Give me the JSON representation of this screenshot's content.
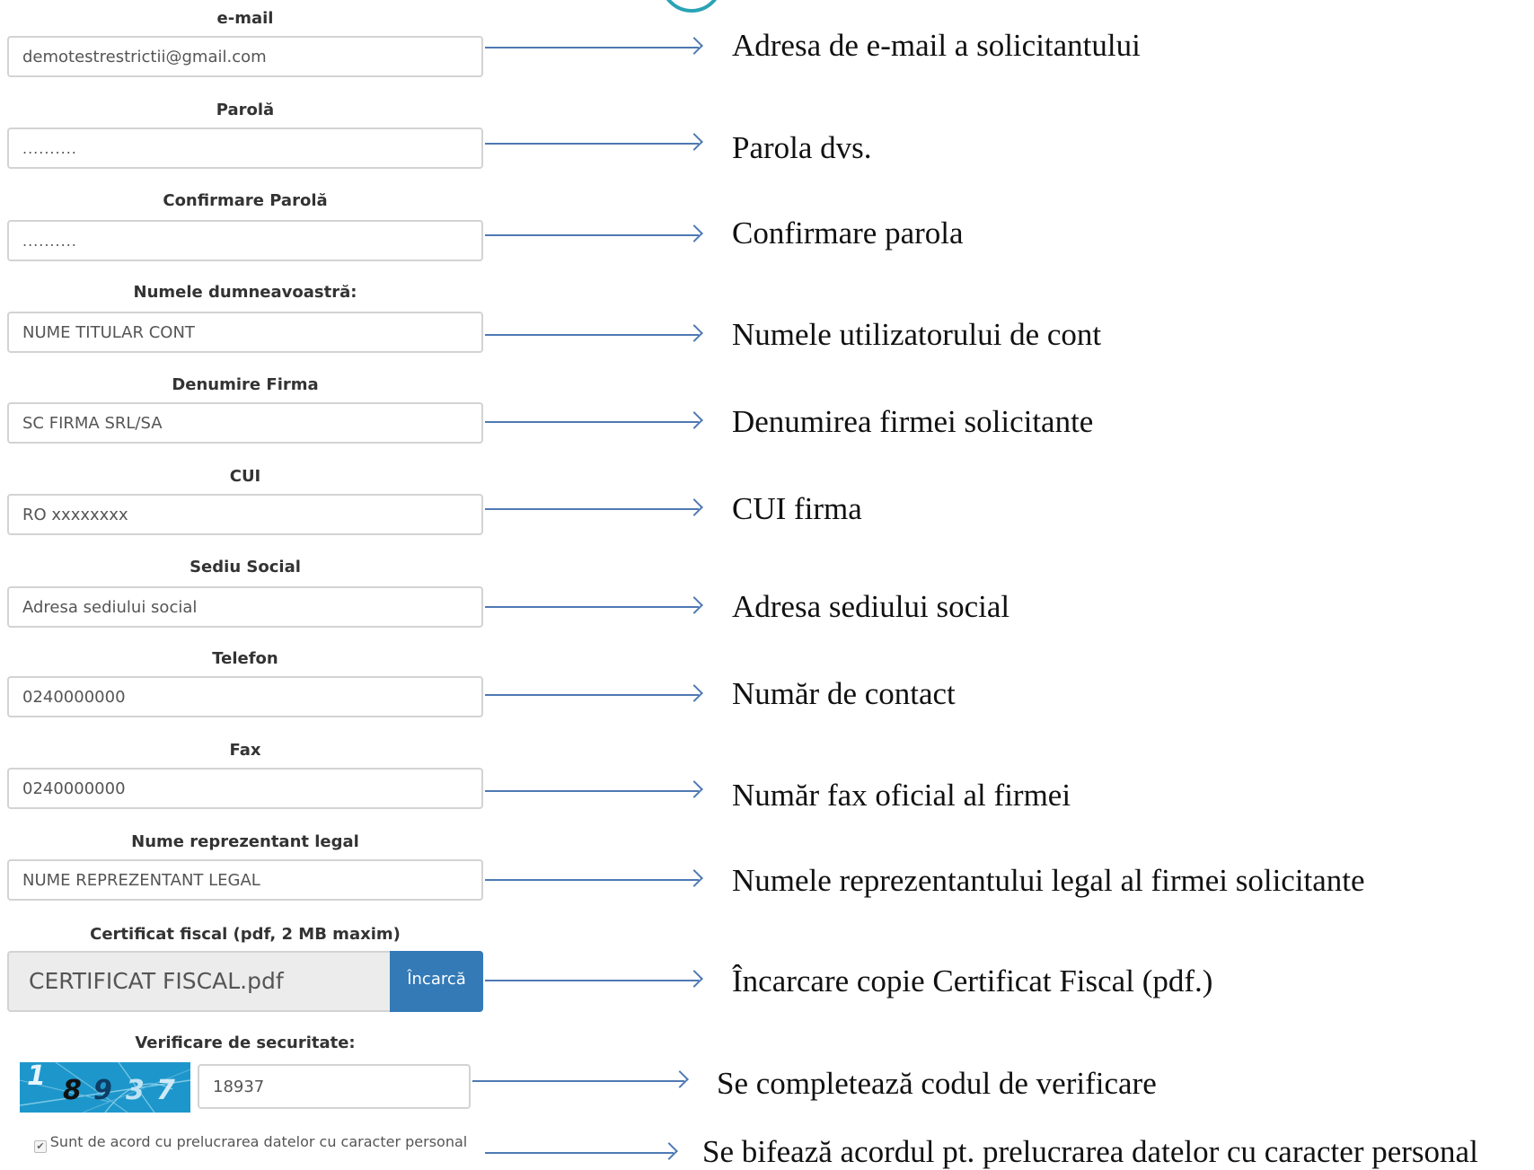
{
  "form": {
    "email": {
      "label": "e-mail",
      "value": "demotestrestrictii@gmail.com",
      "note": "Adresa de e-mail a solicitantului"
    },
    "password": {
      "label": "Parolă",
      "value": "..........",
      "note": "Parola dvs."
    },
    "confirm_password": {
      "label": "Confirmare Parolă",
      "value": "..........",
      "note": "Confirmare parola"
    },
    "name": {
      "label": "Numele dumneavoastră:",
      "value": "NUME TITULAR CONT",
      "note": "Numele utilizatorului de cont"
    },
    "company": {
      "label": "Denumire Firma",
      "value": "SC FIRMA SRL/SA",
      "note": "Denumirea firmei solicitante"
    },
    "cui": {
      "label": "CUI",
      "value": "RO xxxxxxxx",
      "note": "CUI firma"
    },
    "address": {
      "label": "Sediu Social",
      "value": "Adresa sediului social",
      "note": "Adresa sediului social"
    },
    "phone": {
      "label": "Telefon",
      "value": "0240000000",
      "note": "Număr de contact"
    },
    "fax": {
      "label": "Fax",
      "value": "0240000000",
      "note": "Număr fax oficial al firmei"
    },
    "legal_rep": {
      "label": "Nume reprezentant legal",
      "value": "NUME REPREZENTANT LEGAL",
      "note": "Numele reprezentantului legal al firmei solicitante"
    },
    "certificate": {
      "label": "Certificat fiscal (pdf, 2 MB maxim)",
      "file_name": "CERTIFICAT FISCAL.pdf",
      "button": "Încarcă",
      "note": "Încarcare copie Certificat Fiscal (pdf.)"
    },
    "security": {
      "label": "Verificare de securitate:",
      "captcha_digits": [
        "1",
        "8",
        "9",
        "3",
        "7"
      ],
      "value": "18937",
      "note": "Se completează codul de verificare"
    },
    "consent": {
      "checked": true,
      "check_mark": "✔",
      "text": "Sunt de acord cu prelucrarea datelor cu caracter personal",
      "note": "Se bifează acordul pt. prelucrarea datelor cu caracter personal"
    }
  },
  "colors": {
    "arrow": "#4e79b3",
    "button": "#337ab7",
    "captcha_bg": "#1d97cb"
  }
}
